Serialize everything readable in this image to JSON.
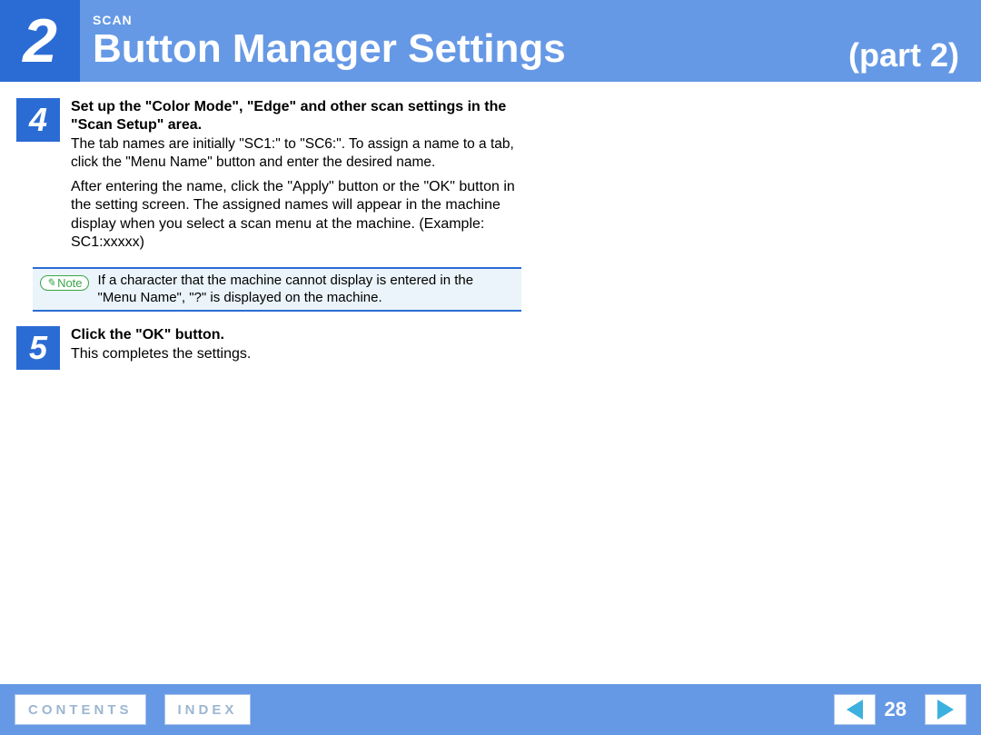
{
  "header": {
    "chapter_number": "2",
    "section_small": "SCAN",
    "title": "Button Manager Settings",
    "part": "(part 2)"
  },
  "steps": {
    "s4": {
      "num": "4",
      "title": "Set up the \"Color Mode\", \"Edge\" and other scan settings in the \"Scan Setup\" area.",
      "sub": "The tab names are initially \"SC1:\" to \"SC6:\". To assign a name to a tab, click the \"Menu Name\" button and enter the desired name.",
      "after": "After entering the name, click the \"Apply\" button or the \"OK\" button in the setting screen. The assigned names will appear in the machine display when you select a scan menu at the machine. (Example: SC1:xxxxx)"
    },
    "note": {
      "label": "Note",
      "text": "If a character that the machine cannot display is entered in the \"Menu Name\", \"?\" is displayed on the machine."
    },
    "s5": {
      "num": "5",
      "title": "Click the \"OK\" button.",
      "body": "This completes the settings."
    }
  },
  "footer": {
    "contents": "CONTENTS",
    "index": "INDEX",
    "page": "28"
  }
}
